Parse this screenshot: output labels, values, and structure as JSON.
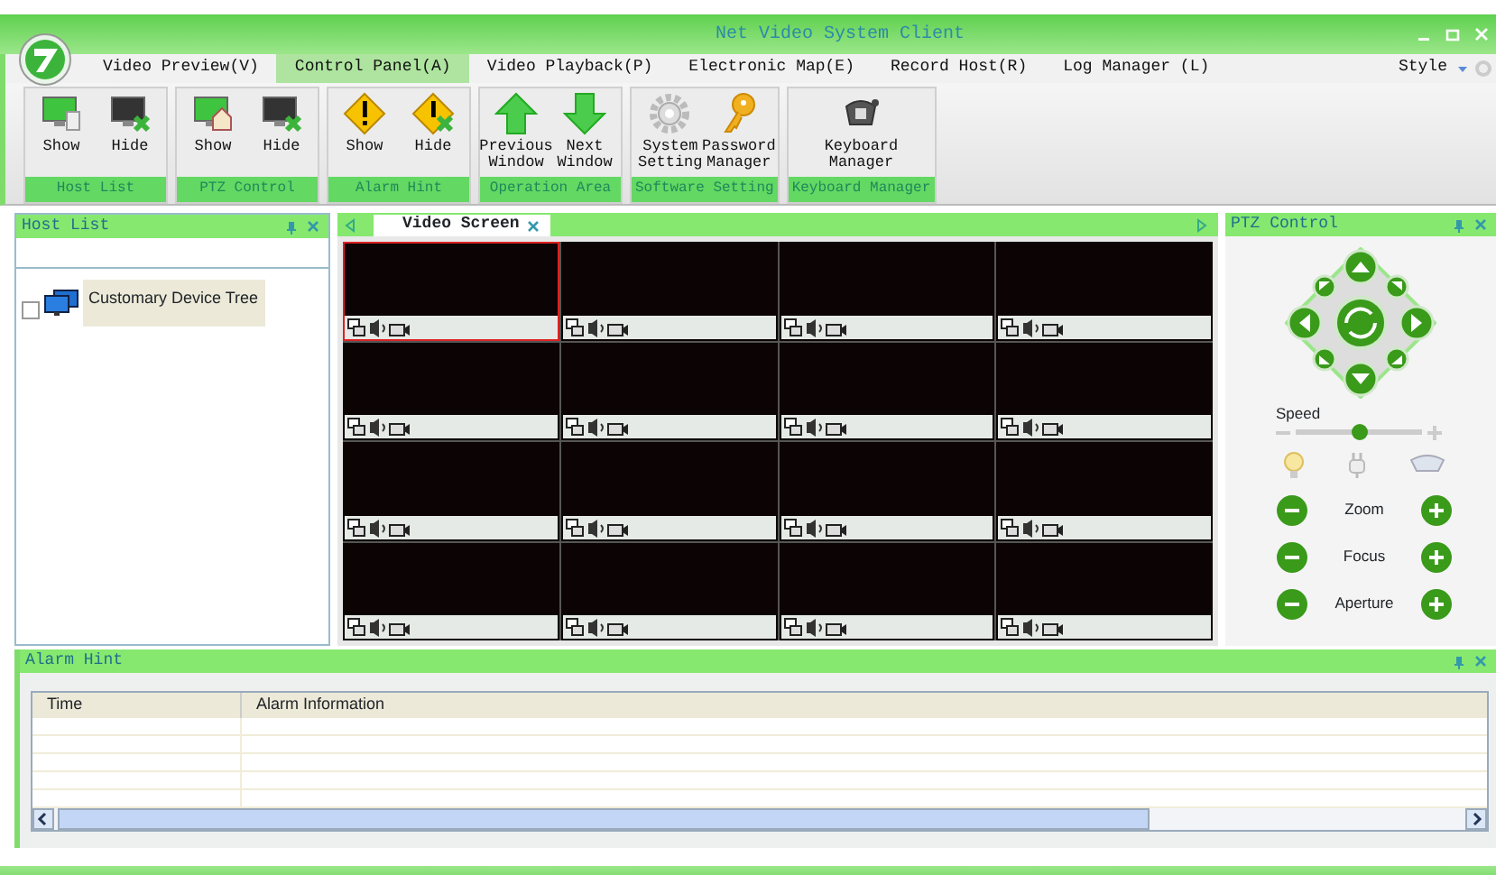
{
  "window": {
    "title": "Net Video System Client"
  },
  "menu_tabs": [
    {
      "label": "Video Preview(V)",
      "selected": false
    },
    {
      "label": "Control Panel(A)",
      "selected": true
    },
    {
      "label": "Video Playback(P)",
      "selected": false
    },
    {
      "label": "Electronic Map(E)",
      "selected": false
    },
    {
      "label": "Record Host(R)",
      "selected": false
    },
    {
      "label": "Log Manager (L)",
      "selected": false
    }
  ],
  "style_menu": {
    "label": "Style"
  },
  "ribbon_groups": [
    {
      "title": "Host List",
      "buttons": [
        {
          "kind": "monitor-show",
          "label": "Show"
        },
        {
          "kind": "monitor-hide",
          "label": "Hide"
        }
      ]
    },
    {
      "title": "PTZ Control",
      "buttons": [
        {
          "kind": "monitor-home",
          "label": "Show"
        },
        {
          "kind": "monitor-hide",
          "label": "Hide"
        }
      ]
    },
    {
      "title": "Alarm Hint",
      "buttons": [
        {
          "kind": "warning",
          "label": "Show"
        },
        {
          "kind": "warning-hide",
          "label": "Hide"
        }
      ]
    },
    {
      "title": "Operation Area",
      "buttons": [
        {
          "kind": "arrow-up",
          "label": "Previous Window"
        },
        {
          "kind": "arrow-down",
          "label": "Next Window"
        }
      ]
    },
    {
      "title": "Software Setting",
      "buttons": [
        {
          "kind": "gear",
          "label": "System Setting"
        },
        {
          "kind": "key",
          "label": "Password Manager"
        }
      ]
    },
    {
      "title": "Keyboard Manager",
      "buttons": [
        {
          "kind": "keyboard",
          "label": "Keyboard Manager"
        }
      ]
    }
  ],
  "host_list": {
    "title": "Host List",
    "tree": [
      {
        "label": "Customary Device Tree",
        "checked": false
      }
    ]
  },
  "video_screen": {
    "tab": "Video Screen",
    "cells": [
      {
        "selected": true
      },
      {
        "selected": false
      },
      {
        "selected": false
      },
      {
        "selected": false
      },
      {
        "selected": false
      },
      {
        "selected": false
      },
      {
        "selected": false
      },
      {
        "selected": false
      },
      {
        "selected": false
      },
      {
        "selected": false
      },
      {
        "selected": false
      },
      {
        "selected": false
      },
      {
        "selected": false
      },
      {
        "selected": false
      },
      {
        "selected": false
      },
      {
        "selected": false
      }
    ]
  },
  "ptz_control": {
    "title": "PTZ Control",
    "speed": {
      "label": "Speed",
      "level": 0.5
    },
    "adjust_rows": [
      {
        "label": "Zoom"
      },
      {
        "label": "Focus"
      },
      {
        "label": "Aperture"
      }
    ]
  },
  "alarm_hint": {
    "title": "Alarm Hint",
    "columns": [
      "Time",
      "Alarm Information"
    ]
  }
}
